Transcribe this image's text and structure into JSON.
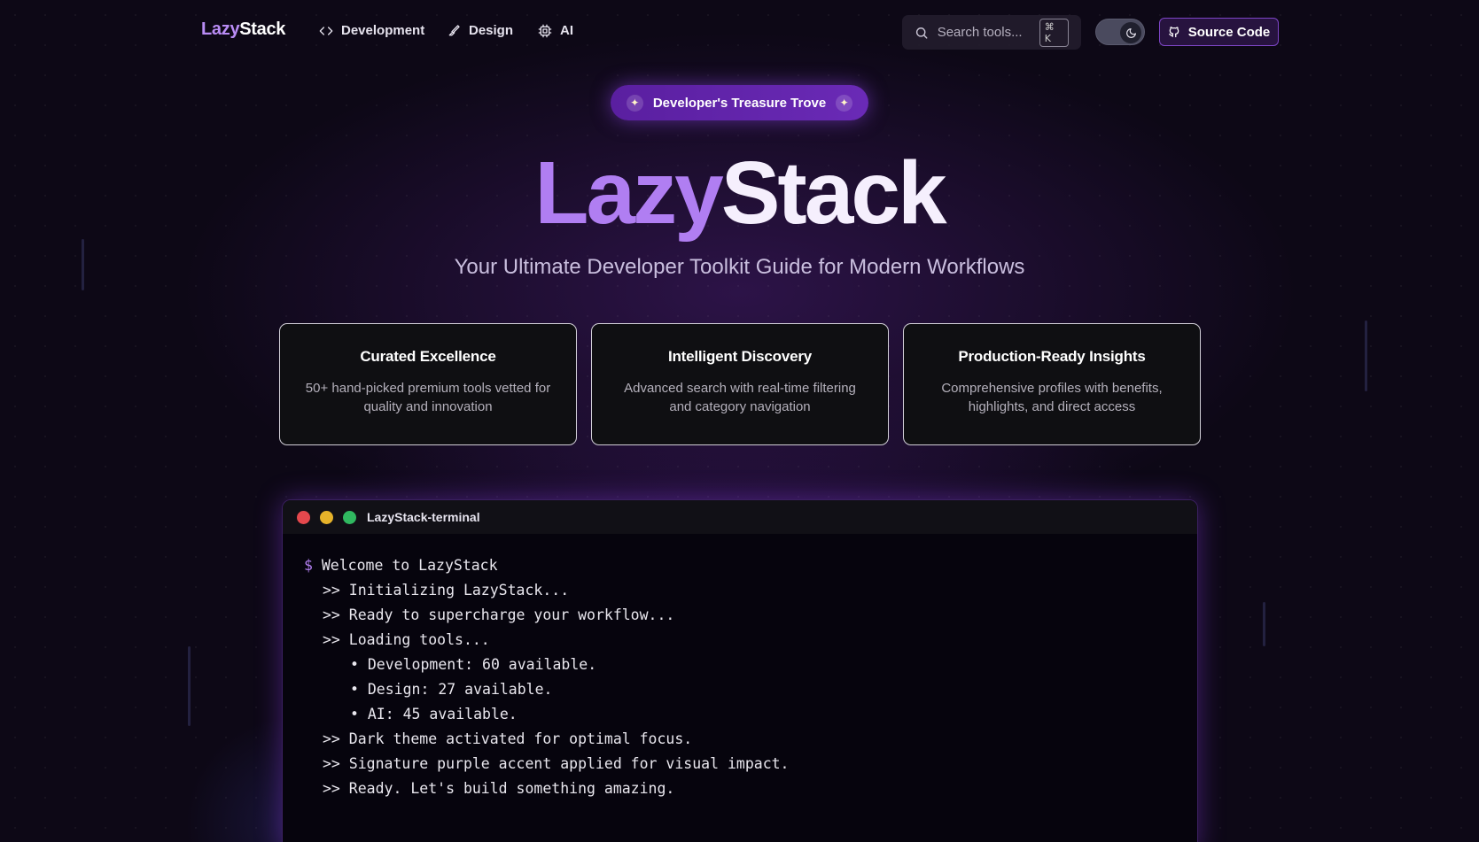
{
  "logo": {
    "part1": "Lazy",
    "part2": "Stack"
  },
  "nav": [
    {
      "label": "Development",
      "icon": "code-icon"
    },
    {
      "label": "Design",
      "icon": "brush-icon"
    },
    {
      "label": "AI",
      "icon": "cpu-icon"
    }
  ],
  "search": {
    "placeholder": "Search tools...",
    "shortcut": "⌘ K"
  },
  "theme_toggle": {
    "state": "dark"
  },
  "source_button": {
    "label": "Source Code"
  },
  "hero": {
    "pill": "Developer's Treasure Trove",
    "title_part1": "Lazy",
    "title_part2": "Stack",
    "subtitle": "Your Ultimate Developer Toolkit Guide for Modern Workflows"
  },
  "features": [
    {
      "title": "Curated Excellence",
      "description": "50+ hand-picked premium tools vetted for quality and innovation"
    },
    {
      "title": "Intelligent Discovery",
      "description": "Advanced search with real-time filtering and category navigation"
    },
    {
      "title": "Production-Ready Insights",
      "description": "Comprehensive profiles with benefits, highlights, and direct access"
    }
  ],
  "terminal": {
    "title": "LazyStack-terminal",
    "prompt": "$",
    "command": "Welcome to LazyStack",
    "lines": [
      ">> Initializing LazyStack...",
      ">> Ready to supercharge your workflow...",
      ">> Loading tools...",
      "• Development: 60 available.",
      "• Design: 27 available.",
      "• AI: 45 available.",
      ">> Dark theme activated for optimal focus.",
      ">> Signature purple accent applied for visual impact.",
      ">> Ready. Let's build something amazing."
    ]
  },
  "colors": {
    "accent": "#b07ef2",
    "background": "#0d0816",
    "dot_red": "#e5484d",
    "dot_yellow": "#e6b22a",
    "dot_green": "#30b860"
  }
}
